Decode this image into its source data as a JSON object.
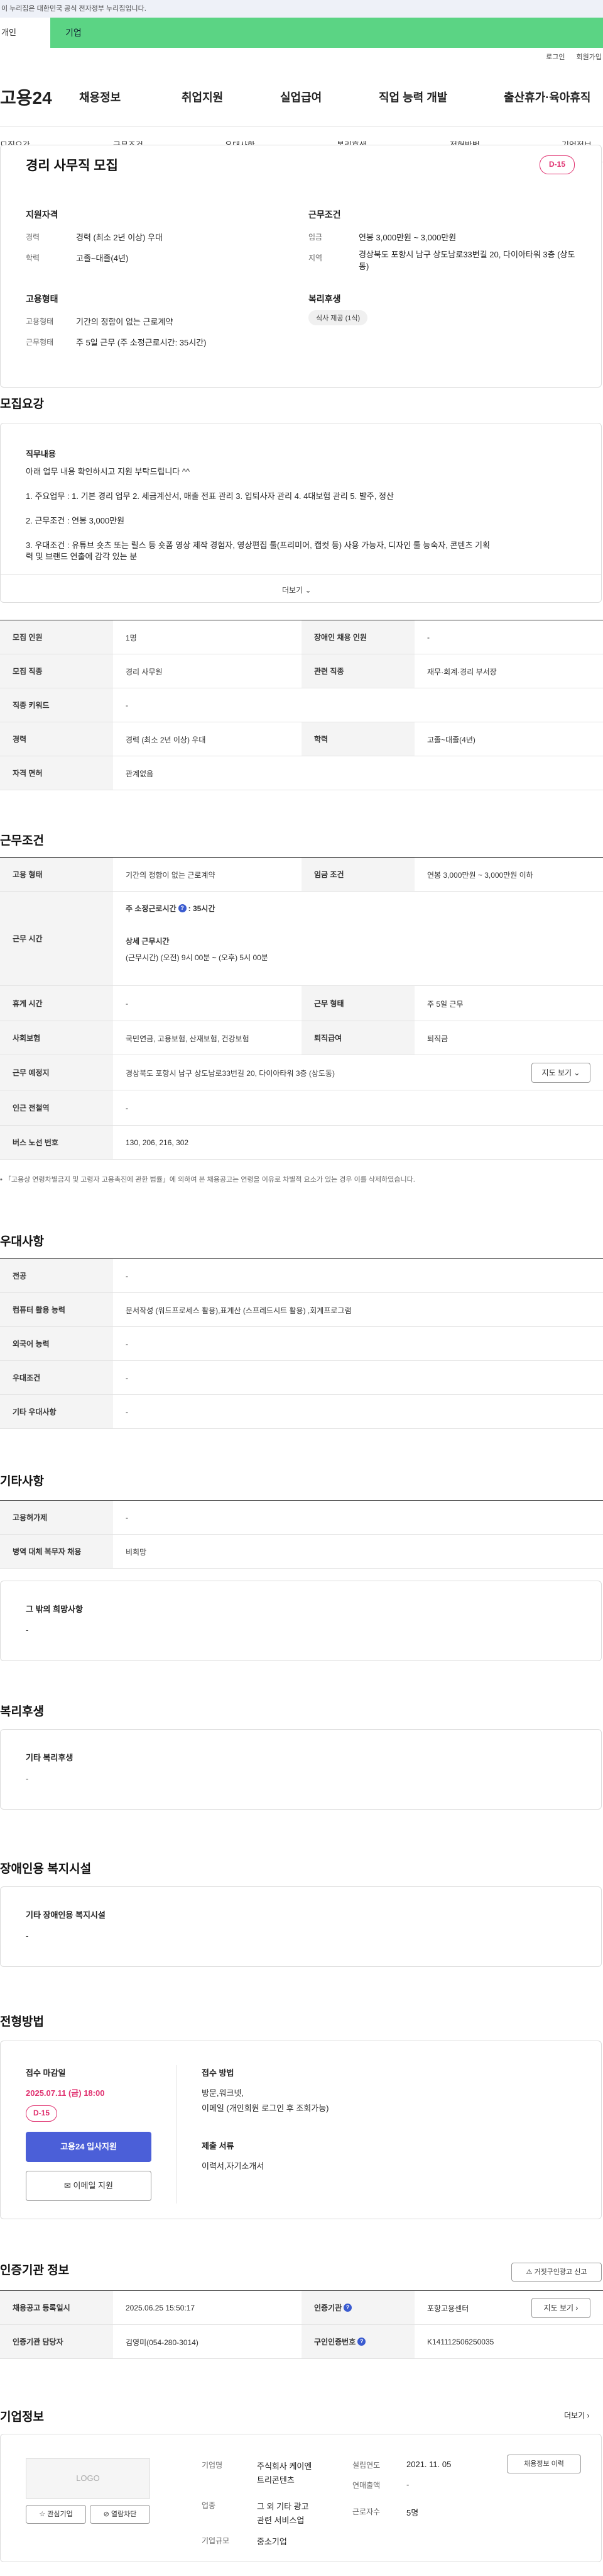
{
  "gov_banner": "이 누리집은 대한민국 공식 전자정부 누리집입니다.",
  "top_tabs": {
    "individual": "개인",
    "corporate": "기업"
  },
  "util": {
    "login": "로그인",
    "signup": "회원가입"
  },
  "gnb": {
    "logo": "고용24",
    "menu": [
      "채용정보",
      "취업지원",
      "실업급여",
      "직업 능력 개발",
      "출산휴가·육아휴직"
    ]
  },
  "subnav": [
    "모집요강",
    "근무조건",
    "우대사항",
    "복리후생",
    "전형방법",
    "기업정보"
  ],
  "summary": {
    "title": "경리 사무직 모집",
    "dday": "D-15",
    "qual_head": "지원자격",
    "career_label": "경력",
    "career": "경력 (최소 2년 이상) 우대",
    "edu_label": "학력",
    "edu": "고졸~대졸(4년)",
    "cond_head": "근무조건",
    "wage_label": "임금",
    "wage": "연봉 3,000만원 ~ 3,000만원",
    "loc_label": "지역",
    "loc": "경상북도 포항시 남구 상도남로33번길 20, 다이아타워 3층 (상도동)",
    "emp_head": "고용형태",
    "type_label": "고용형태",
    "type": "기간의 정함이 없는 근로계약",
    "form_label": "근무형태",
    "form": "주 5일 근무 (주 소정근로시간: 35시간)",
    "welfare_head": "복리후생",
    "welfare_tag": "식사 제공 (1식)"
  },
  "recruit": {
    "section_title": "모집요강",
    "duties_head": "직무내용",
    "intro": "아래 업무 내용 확인하시고 지원 부탁드립니다 ^^",
    "line1": "1. 주요업무 : 1. 기본 경리 업무 2. 세금계산서, 매출 전표 관리 3. 입퇴사자 관리 4. 4대보험 관리 5. 발주, 정산",
    "line2": "2. 근무조건 : 연봉 3,000만원",
    "line3a": "3. 우대조건 : 유튜브 숏츠 또는 릴스 등 숏폼 영상 제작 경험자, 영상편집 툴(프리미어, 캡컷 등) 사용 가능자, 디자인 툴 능숙자, 콘텐츠 기획",
    "line3b": "력 및 브랜드 연출에 감각 있는 분",
    "more": "더보기",
    "rows": {
      "count_l": "모집 인원",
      "count": "1명",
      "disabled_l": "장애인 채용 인원",
      "disabled": "-",
      "job_l": "모집 직종",
      "job": "경리 사무원",
      "related_l": "관련 직종",
      "related": "재무·회계·경리 부서장",
      "kw_l": "직종 키워드",
      "kw": "-",
      "career_l": "경력",
      "career": "경력 (최소 2년 이상) 우대",
      "edu_l": "학력",
      "edu": "고졸~대졸(4년)",
      "lic_l": "자격 면허",
      "lic": "관계없음"
    }
  },
  "work": {
    "section_title": "근무조건",
    "emptype_l": "고용 형태",
    "emptype": "기간의 정함이 없는 근로계약",
    "wage_l": "임금 조건",
    "wage": "연봉 3,000만원 ~ 3,000만원 이하",
    "hours_l": "근무 시간",
    "hours_sub": "주 소정근로시간",
    "hours_val": ": 35시간",
    "detail_sub": "상세 근무시간",
    "detail_val": "(근무시간) (오전) 9시 00분 ~ (오후) 5시 00분",
    "rest_l": "휴게 시간",
    "rest": "-",
    "form_l": "근무 형태",
    "form": "주 5일 근무",
    "ins_l": "사회보험",
    "ins": "국민연금, 고용보험, 산재보험, 건강보험",
    "ret_l": "퇴직급여",
    "ret": "퇴직금",
    "place_l": "근무 예정지",
    "place": "경상북도 포항시 남구 상도남로33번길 20, 다이아타워 3층 (상도동)",
    "map_btn": "지도 보기",
    "subway_l": "인근 전철역",
    "subway": "-",
    "bus_l": "버스 노선 번호",
    "bus": "130, 206, 216, 302",
    "note": "「고용상 연령차별금지 및 고령자 고용촉진에 관한 법률」에 의하여 본 채용공고는 연령을 이유로 차별적 요소가 있는 경우 이를 삭제하였습니다."
  },
  "pref": {
    "section_title": "우대사항",
    "major_l": "전공",
    "major": "-",
    "pc_l": "컴퓨터 활용 능력",
    "pc": "문서작성 (워드프로세스 활용),표계산 (스프레드시트 활용) ,회계프로그램",
    "lang_l": "외국어 능력",
    "lang": "-",
    "cond_l": "우대조건",
    "cond": "-",
    "etc_l": "기타 우대사항",
    "etc": "-"
  },
  "etc": {
    "section_title": "기타사항",
    "hire_l": "고용허가제",
    "hire": "-",
    "mil_l": "병역 대체 복무자 채용",
    "mil": "비희망",
    "other_head": "그 밖의 희망사항",
    "other": "-"
  },
  "welfare": {
    "section_title": "복리후생",
    "head": "기타 복리후생",
    "val": "-"
  },
  "facility": {
    "section_title": "장애인용 복지시설",
    "head": "기타 장애인용 복지시설",
    "val": "-"
  },
  "selection": {
    "section_title": "전형방법",
    "deadline_head": "접수 마감일",
    "deadline": "2025.07.11 (금) 18:00",
    "dday": "D-15",
    "apply_btn": "고용24 입사지원",
    "email_btn": "이메일 지원",
    "method_head": "접수 방법",
    "method1": "방문,워크넷,",
    "method2": "이메일 (개인회원 로그인 후 조회가능)",
    "docs_head": "제출 서류",
    "docs": "이력서,자기소개서"
  },
  "agency": {
    "section_title": "인증기관 정보",
    "report_btn": "거짓구인광고 신고",
    "reg_l": "채용공고 등록일시",
    "reg": "2025.06.25 15:50:17",
    "org_l": "인증기관",
    "org": "포항고용센터",
    "map_btn": "지도 보기",
    "mgr_l": "인증기관 담당자",
    "mgr": "김영미(054-280-3014)",
    "id_l": "구인인증번호",
    "id": "K141112506250035"
  },
  "company": {
    "section_title": "기업정보",
    "more": "더보기",
    "logo": "LOGO",
    "fav_btn": "관심기업",
    "block_btn": "열람차단",
    "name_l": "기업명",
    "name1": "주식회사 케이엔",
    "name2": "트리콘텐츠",
    "founded_l": "설립연도",
    "founded": "2021. 11. 05",
    "status_btn": "채용정보 이력",
    "revenue_l": "연매출액",
    "revenue": "-",
    "industry_l": "업종",
    "industry1": "그 외 기타 광고",
    "industry2": "관련 서비스업",
    "emp_l": "근로자수",
    "emp": "5명",
    "size_l": "기업규모",
    "size": "중소기업"
  }
}
